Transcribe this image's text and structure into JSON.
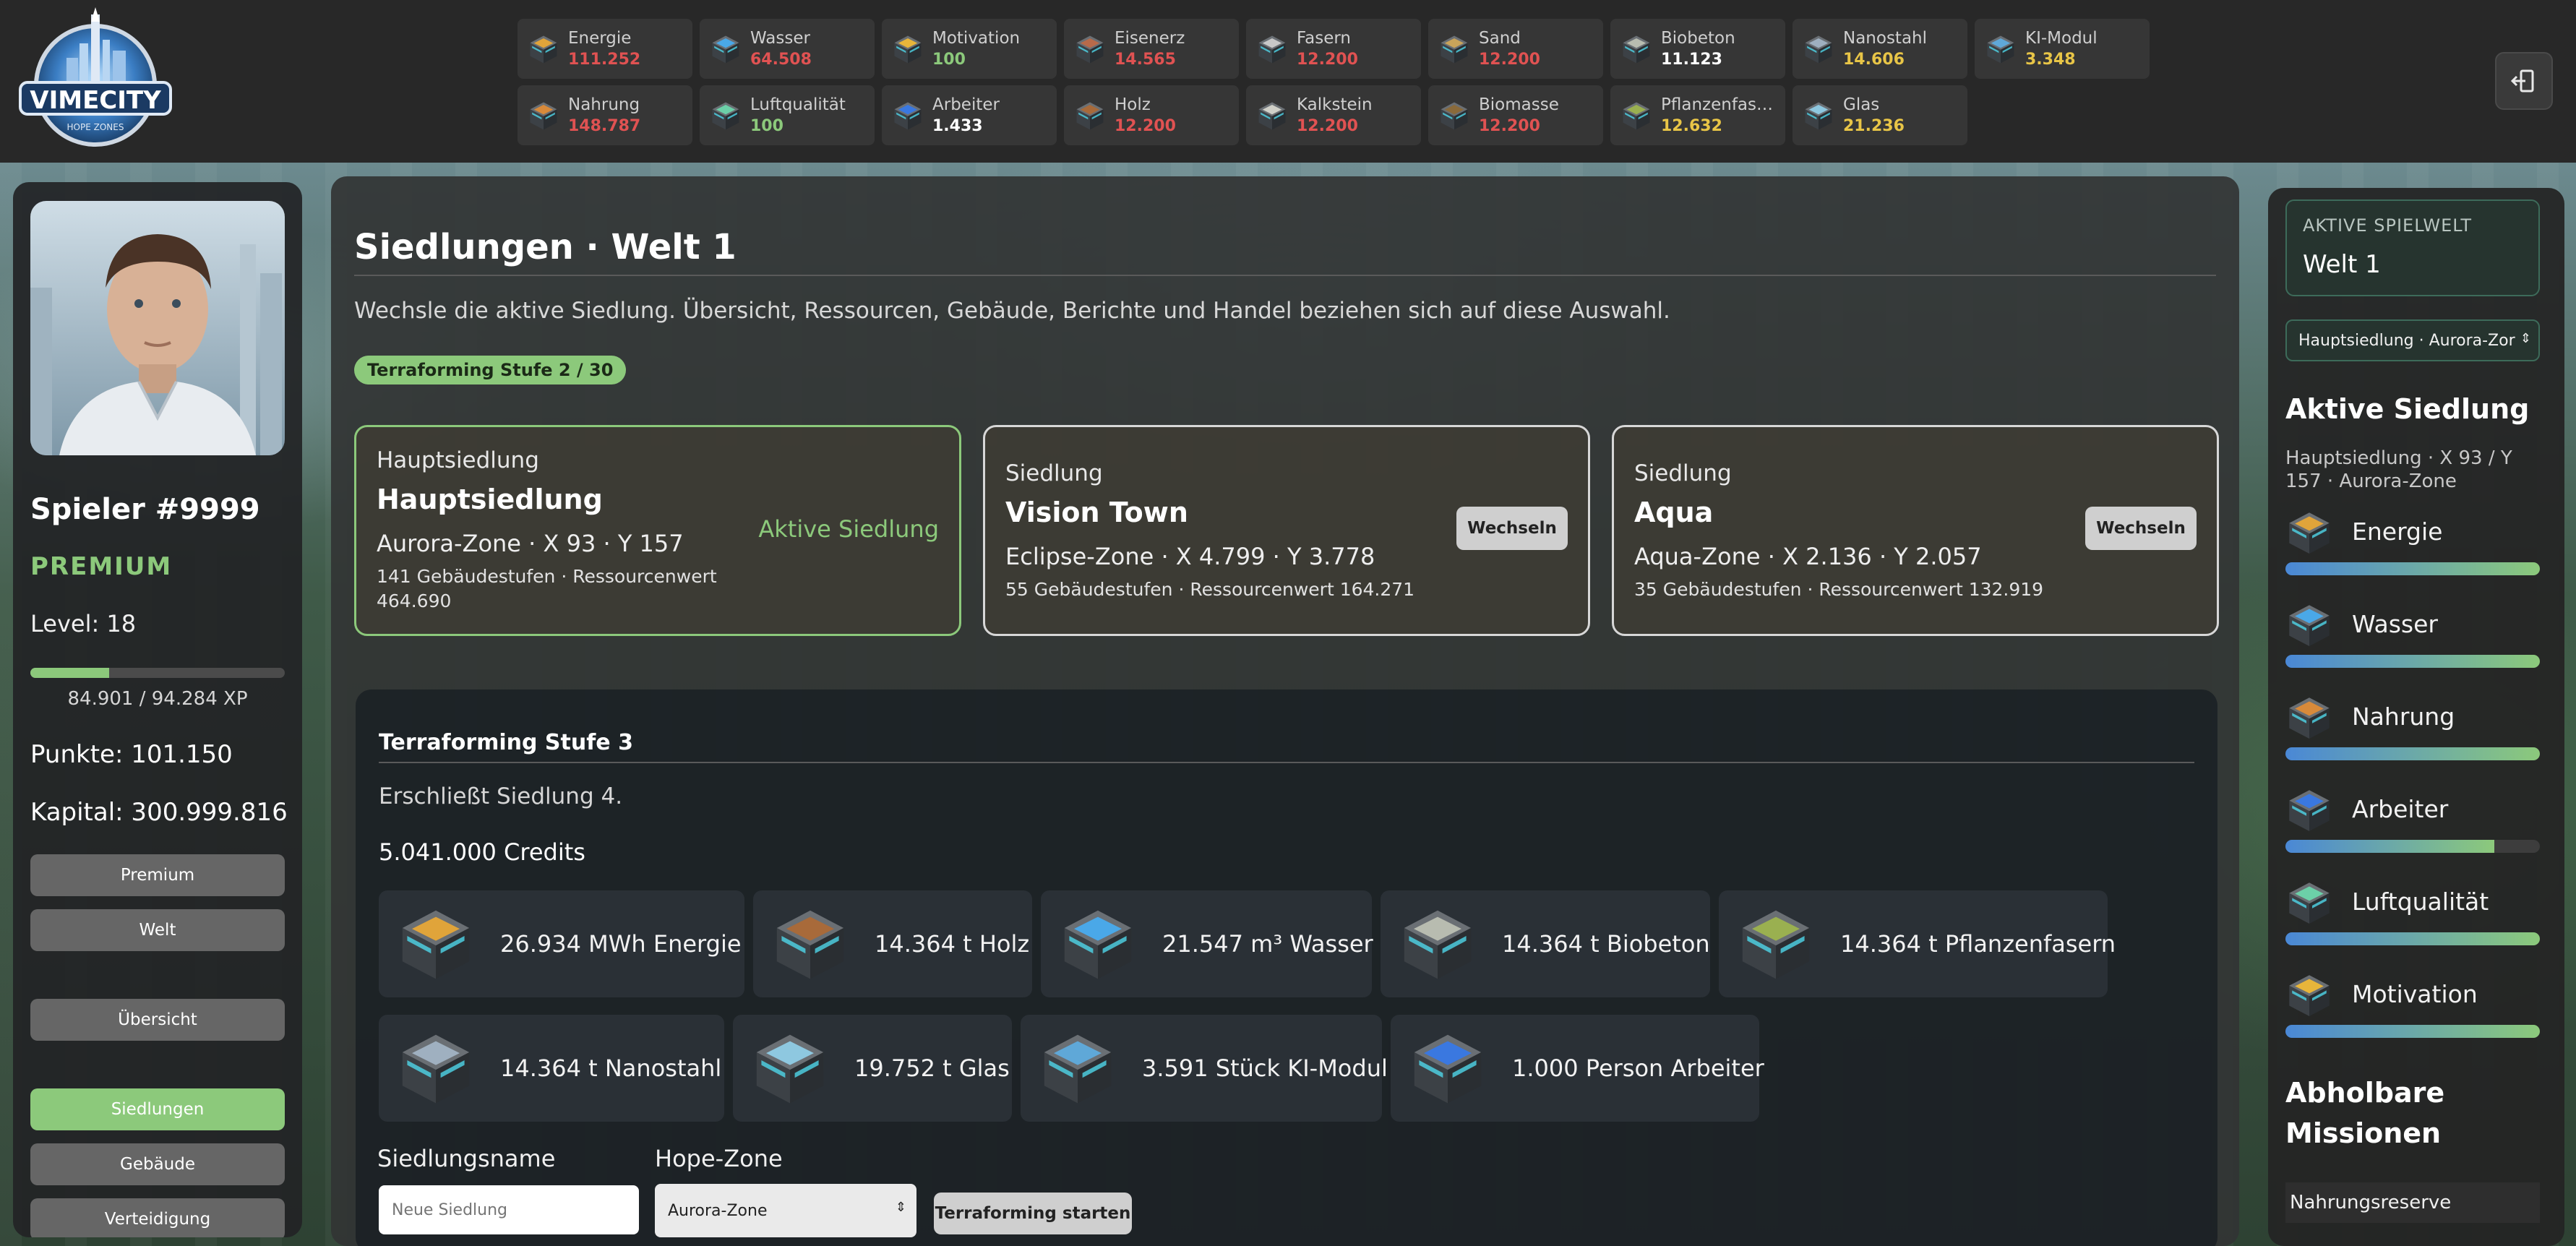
{
  "app": {
    "logo_text": "VIMECITY",
    "logo_sub": "HOPE ZONES"
  },
  "resources": [
    {
      "name": "Energie",
      "value": "111.252",
      "color": "#e05252",
      "icon": "energy-crate-icon"
    },
    {
      "name": "Wasser",
      "value": "64.508",
      "color": "#e05252",
      "icon": "water-crate-icon"
    },
    {
      "name": "Motivation",
      "value": "100",
      "color": "#8cc97b",
      "icon": "motivation-crate-icon"
    },
    {
      "name": "Eisenerz",
      "value": "14.565",
      "color": "#e05252",
      "icon": "iron-ore-crate-icon"
    },
    {
      "name": "Fasern",
      "value": "12.200",
      "color": "#e05252",
      "icon": "fiber-crate-icon"
    },
    {
      "name": "Sand",
      "value": "12.200",
      "color": "#e05252",
      "icon": "sand-crate-icon"
    },
    {
      "name": "Biobeton",
      "value": "11.123",
      "color": "#ffffff",
      "icon": "biobeton-crate-icon"
    },
    {
      "name": "Nanostahl",
      "value": "14.606",
      "color": "#e8c547",
      "icon": "nanosteel-crate-icon"
    },
    {
      "name": "KI-Modul",
      "value": "3.348",
      "color": "#e8c547",
      "icon": "ai-module-crate-icon"
    },
    {
      "name": "Nahrung",
      "value": "148.787",
      "color": "#e05252",
      "icon": "food-crate-icon"
    },
    {
      "name": "Luftqualität",
      "value": "100",
      "color": "#8cc97b",
      "icon": "air-quality-crate-icon"
    },
    {
      "name": "Arbeiter",
      "value": "1.433",
      "color": "#ffffff",
      "icon": "worker-crate-icon"
    },
    {
      "name": "Holz",
      "value": "12.200",
      "color": "#e05252",
      "icon": "wood-crate-icon"
    },
    {
      "name": "Kalkstein",
      "value": "12.200",
      "color": "#e05252",
      "icon": "limestone-crate-icon"
    },
    {
      "name": "Biomasse",
      "value": "12.200",
      "color": "#e05252",
      "icon": "biomass-crate-icon"
    },
    {
      "name": "Pflanzenfas…",
      "value": "12.632",
      "color": "#e8c547",
      "icon": "plant-fiber-crate-icon"
    },
    {
      "name": "Glas",
      "value": "21.236",
      "color": "#e8c547",
      "icon": "glass-crate-icon"
    }
  ],
  "player": {
    "name": "Spieler #9999",
    "status": "PREMIUM",
    "level": "Level: 18",
    "xp_fraction": 0.31,
    "xp_text": "84.901 / 94.284 XP",
    "points": "Punkte: 101.150",
    "capital": "Kapital: 300.999.816"
  },
  "nav": {
    "premium": "Premium",
    "welt": "Welt",
    "uebersicht": "Übersicht",
    "siedlungen": "Siedlungen",
    "gebaeude": "Gebäude",
    "verteidigung": "Verteidigung"
  },
  "main": {
    "title": "Siedlungen · Welt 1",
    "description": "Wechsle die aktive Siedlung. Übersicht, Ressourcen, Gebäude, Berichte und Handel beziehen sich auf diese Auswahl.",
    "terraforming_badge": "Terraforming Stufe 2 / 30"
  },
  "settlements": [
    {
      "kind": "Hauptsiedlung",
      "name": "Hauptsiedlung",
      "zone": "Aurora-Zone · X 93 · Y 157",
      "meta": "141 Gebäudestufen · Ressourcenwert 464.690",
      "action": "Aktive Siedlung"
    },
    {
      "kind": "Siedlung",
      "name": "Vision Town",
      "zone": "Eclipse-Zone · X 4.799 · Y 3.778",
      "meta": "55 Gebäudestufen · Ressourcenwert 164.271",
      "action": "Wechseln"
    },
    {
      "kind": "Siedlung",
      "name": "Aqua",
      "zone": "Aqua-Zone · X 2.136 · Y 2.057",
      "meta": "35 Gebäudestufen · Ressourcenwert 132.919",
      "action": "Wechseln"
    }
  ],
  "terraforming": {
    "title": "Terraforming Stufe 3",
    "subtitle": "Erschließt Siedlung 4.",
    "credits": "5.041.000 Credits",
    "costs": [
      {
        "text": "26.934 MWh Energie",
        "icon": "energy-crate-icon"
      },
      {
        "text": "14.364 t Holz",
        "icon": "wood-crate-icon"
      },
      {
        "text": "21.547 m³ Wasser",
        "icon": "water-crate-icon"
      },
      {
        "text": "14.364 t Biobeton",
        "icon": "biobeton-crate-icon"
      },
      {
        "text": "14.364 t Pflanzenfasern",
        "icon": "plant-fiber-crate-icon"
      },
      {
        "text": "14.364 t Nanostahl",
        "icon": "nanosteel-crate-icon"
      },
      {
        "text": "19.752 t Glas",
        "icon": "glass-crate-icon"
      },
      {
        "text": "3.591 Stück KI-Modul",
        "icon": "ai-module-crate-icon"
      },
      {
        "text": "1.000 Person Arbeiter",
        "icon": "worker-crate-icon"
      }
    ],
    "name_label": "Siedlungsname",
    "name_placeholder": "Neue Siedlung",
    "zone_label": "Hope-Zone",
    "zone_value": "Aurora-Zone",
    "start_label": "Terraforming starten"
  },
  "sidebar_right": {
    "world_label": "AKTIVE SPIELWELT",
    "world_value": "Welt 1",
    "settlement_select": "Hauptsiedlung · Aurora-Zor",
    "active_title": "Aktive Siedlung",
    "active_sub": "Hauptsiedlung · X 93 / Y 157 · Aurora-Zone",
    "stats": [
      {
        "name": "Energie",
        "fill": 1.0,
        "icon": "energy-crate-icon"
      },
      {
        "name": "Wasser",
        "fill": 1.0,
        "icon": "water-crate-icon"
      },
      {
        "name": "Nahrung",
        "fill": 1.0,
        "icon": "food-crate-icon"
      },
      {
        "name": "Arbeiter",
        "fill": 0.82,
        "icon": "worker-crate-icon"
      },
      {
        "name": "Luftqualität",
        "fill": 1.0,
        "icon": "air-quality-crate-icon"
      },
      {
        "name": "Motivation",
        "fill": 1.0,
        "icon": "motivation-crate-icon"
      }
    ],
    "missions_title": "Abholbare Missionen",
    "mission_first": "Nahrungsreserve"
  },
  "colors": {
    "accent": "#8cc97b",
    "negative": "#e05252",
    "warning": "#e8c547"
  }
}
